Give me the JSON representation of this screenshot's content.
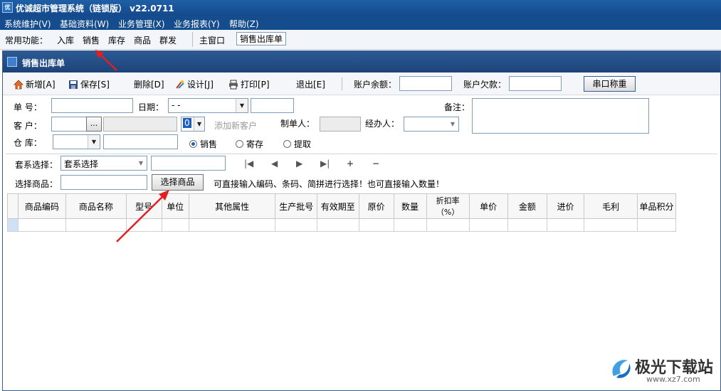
{
  "app": {
    "title": "优诚超市管理系统（链锁版）   v22.0711"
  },
  "menubar": {
    "items": [
      "系统维护(V)",
      "基础资料(W)",
      "业务管理(X)",
      "业务报表(Y)",
      "帮助(Z)"
    ]
  },
  "quickbar": {
    "label": "常用功能：",
    "items": [
      "入库",
      "销售",
      "库存",
      "商品",
      "群发"
    ],
    "tabs": [
      "主窗口",
      "销售出库单"
    ]
  },
  "window": {
    "title": "销售出库单"
  },
  "toolbar": {
    "new": "新增[A]",
    "save": "保存[S]",
    "delete": "删除[D]",
    "design": "设计[J]",
    "print": "打印[P]",
    "exit": "退出[E]",
    "balance_label": "账户余额：",
    "debt_label": "账户欠款：",
    "scale_button": "串口称重"
  },
  "form": {
    "order_no_label": "单    号：",
    "date_label": "日期：",
    "date_value": "- -",
    "note_label": "备注：",
    "customer_label": "客    户：",
    "customer_btn": "...",
    "customer_code": "0",
    "add_customer": "添加新客户",
    "maker_label": "制单人：",
    "handler_label": "经办人：",
    "warehouse_label": "仓    库：",
    "radio_sale": "销售",
    "radio_consign": "寄存",
    "radio_pickup": "提取"
  },
  "selector": {
    "set_label": "套系选择：",
    "set_value": "套系选择",
    "product_label": "选择商品：",
    "product_button": "选择商品",
    "hint": "可直接输入编码、条码、简拼进行选择！也可直接输入数量！",
    "nav": [
      "|◀",
      "◀",
      "▶",
      "▶|",
      "+",
      "−"
    ]
  },
  "grid": {
    "columns": [
      "商品编码",
      "商品名称",
      "型号",
      "单位",
      "其他属性",
      "生产批号",
      "有效期至",
      "原价",
      "数量",
      "折扣率（%）",
      "单价",
      "金额",
      "进价",
      "毛利",
      "单品积分"
    ]
  },
  "watermark": {
    "title": "极光下载站",
    "url": "www.xz7.com"
  },
  "colors": {
    "titlebar": "#1f5fa6",
    "window_title": "#2c5a94",
    "arrow": "#e02020"
  }
}
